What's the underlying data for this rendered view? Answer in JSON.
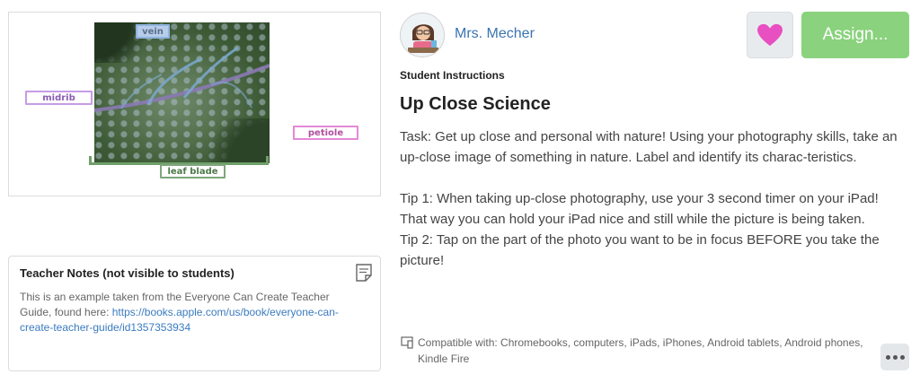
{
  "image": {
    "labels": {
      "vein": "vein",
      "midrib": "midrib",
      "petiole": "petiole",
      "leaf_blade": "leaf blade"
    }
  },
  "teacher_notes": {
    "title": "Teacher Notes (not visible to students)",
    "text": "This is an example taken from the Everyone Can Create Teacher Guide, found here: ",
    "link": "https://books.apple.com/us/book/everyone-can-create-teacher-guide/id1357353934",
    "icon": "note-icon"
  },
  "teacher": {
    "name": "Mrs. Mecher",
    "avatar_icon": "teacher-avatar"
  },
  "buttons": {
    "like_icon": "heart-icon",
    "assign_label": "Assign...",
    "more_icon": "more-icon"
  },
  "colors": {
    "assign": "#8ad27d",
    "heart": "#e84fc0",
    "link": "#3a7bbf"
  },
  "activity": {
    "section_label": "Student Instructions",
    "title": "Up Close Science",
    "task": "Task: Get up close and personal with nature! Using your photography skills, take an up-close image of something in nature. Label and identify its charac-teristics.",
    "tip1": "Tip 1: When taking up-close photography, use your 3 second timer on your iPad! That way you can hold your iPad nice and still while the picture is being taken.",
    "tip2": "Tip 2: Tap on the part of the photo you want to be in focus BEFORE you take the picture!"
  },
  "compatibility": {
    "icon": "device-icon",
    "text": "Compatible with: Chromebooks, computers, iPads, iPhones, Android tablets, Android phones, Kindle Fire"
  }
}
